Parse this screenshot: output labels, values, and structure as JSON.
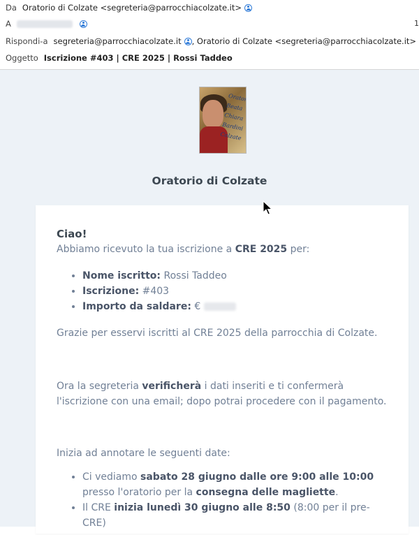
{
  "header": {
    "from_label": "Da",
    "from_value": "Oratorio di Colzate <segreteria@parrocchiacolzate.it>",
    "to_label": "A",
    "replyto_label": "Rispondi-a",
    "replyto_value": "segreteria@parrocchiacolzate.it",
    "replyto_value2": ", Oratorio di Colzate <segreteria@parrocchiacolzate.it>",
    "subject_label": "Oggetto",
    "subject_value": "Iscrizione #403 | CRE 2025 | Rossi Taddeo",
    "right_edge_text": "1"
  },
  "body": {
    "brand": "Oratorio di Colzate",
    "greeting": "Ciao!",
    "intro_a": "Abbiamo ricevuto la tua iscrizione a ",
    "intro_b": "CRE 2025",
    "intro_c": " per:",
    "items": [
      {
        "label": "Nome iscritto:",
        "value": " Rossi Taddeo"
      },
      {
        "label": "Iscrizione:",
        "value": " #403"
      },
      {
        "label": "Importo da saldare:",
        "value": " €"
      }
    ],
    "thanks": "Grazie per esservi iscritti al CRE 2025 della parrocchia di Colzate.",
    "verify_a": "Ora la segreteria ",
    "verify_b": "verificherà",
    "verify_c": " i dati inseriti e ti confermerà l'iscrizione con una email; dopo potrai procedere con il pagamento.",
    "dates_intro": "Inizia ad annotare le seguenti date:",
    "dates": [
      {
        "a": "Ci vediamo ",
        "b": "sabato 28 giugno dalle ore 9:00 alle 10:00",
        "c": " presso l'oratorio per la ",
        "d": "consegna delle magliette",
        "e": "."
      },
      {
        "a": "Il CRE ",
        "b": "inizia lunedì 30 giugno alle 8:50",
        "c": " (8:00 per il pre-CRE)",
        "d": "",
        "e": ""
      }
    ]
  },
  "logo_text": [
    "Oratorio",
    "Beata",
    "Chiara",
    "Bardini",
    "Colzate"
  ],
  "colors": {
    "accent": "#2f7bd8",
    "background": "#edf2f7",
    "text": "#718096",
    "heading": "#3d4852"
  }
}
